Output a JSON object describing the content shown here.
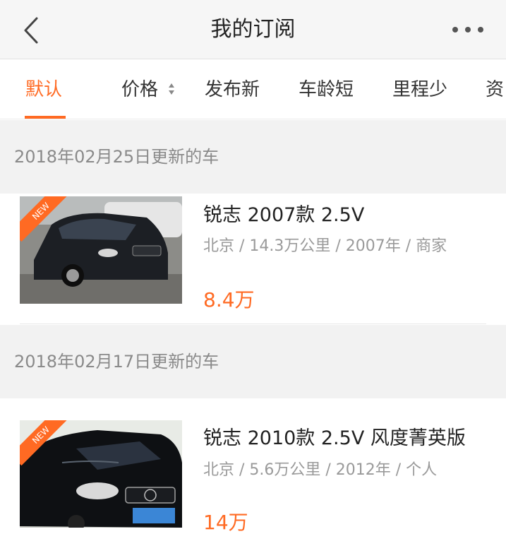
{
  "navbar": {
    "title": "我的订阅",
    "back_icon": "chevron-left-icon",
    "more_icon": "more-dots-icon"
  },
  "tabs": [
    {
      "label": "默认",
      "active": true
    },
    {
      "label": "价格",
      "sortable": true
    },
    {
      "label": "发布新"
    },
    {
      "label": "车龄短"
    },
    {
      "label": "里程少"
    },
    {
      "label": "资"
    }
  ],
  "sections": [
    {
      "header": "2018年02月25日更新的车",
      "cars": [
        {
          "title": "锐志 2007款 2.5V",
          "meta": "北京 / 14.3万公里 / 2007年 / 商家",
          "price": "8.4万",
          "badge": "NEW"
        }
      ]
    },
    {
      "header": "2018年02月17日更新的车",
      "cars": [
        {
          "title": "锐志 2010款 2.5V 风度菁英版",
          "meta": "北京 / 5.6万公里 / 2012年 / 个人",
          "price": "14万",
          "badge": "NEW"
        }
      ]
    }
  ],
  "colors": {
    "accent": "#ff6a23",
    "navbar_bg": "#f6f6f6",
    "section_bg": "#f2f2f2",
    "meta_text": "#9a9a9a"
  }
}
